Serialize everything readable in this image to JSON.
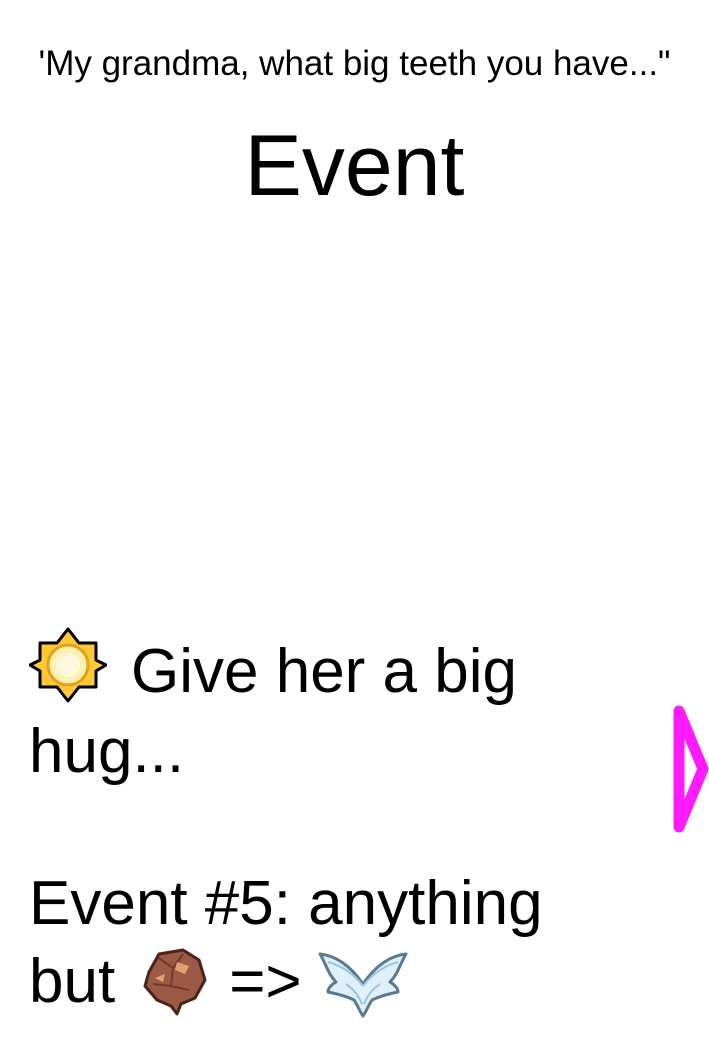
{
  "card": {
    "quote": "'My grandma, what big teeth you have...\"",
    "title": "Event",
    "choice": {
      "icon": "sun-icon",
      "text_line1": "Give her a big",
      "text_line2": "hug..."
    },
    "rule": {
      "line1": "Event #5: anything",
      "line2_prefix": "but",
      "excluded_icon": "rock-resource-icon",
      "arrow": "=>",
      "reward_icon": "wings-icon"
    },
    "next_arrow_icon": "next-arrow-icon"
  },
  "colors": {
    "background": "#ffffff",
    "text": "#000000",
    "accent": "#ff1aff",
    "sun": "#ffc832",
    "rock": "#9c5a46",
    "wing": "#bfe0f5"
  }
}
